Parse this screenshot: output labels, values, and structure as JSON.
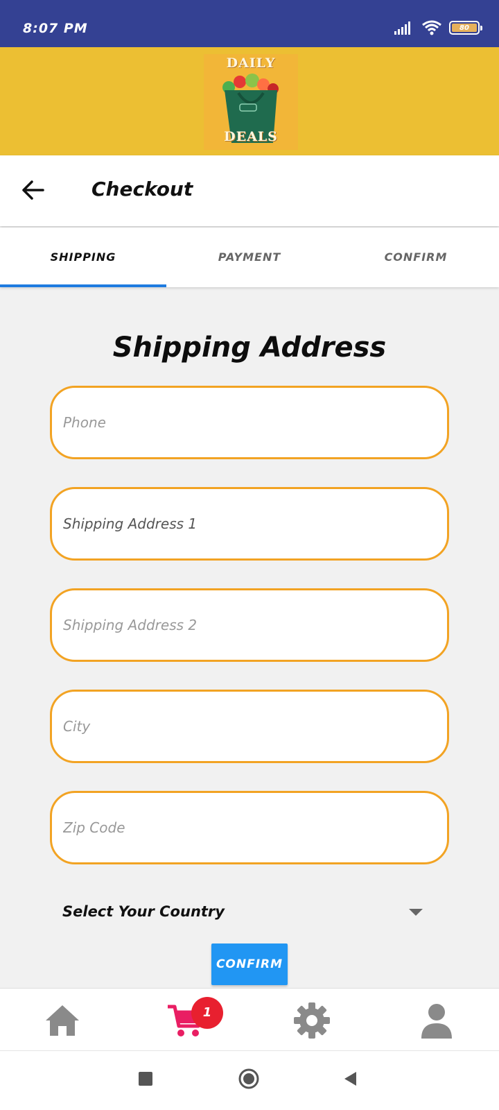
{
  "status_bar": {
    "time": "8:07 PM",
    "battery_level": "80"
  },
  "brand": {
    "logo_top": "DAILY",
    "logo_bottom": "DEALS"
  },
  "app_bar": {
    "title": "Checkout"
  },
  "tabs": [
    {
      "label": "SHIPPING",
      "active": true
    },
    {
      "label": "PAYMENT",
      "active": false
    },
    {
      "label": "CONFIRM",
      "active": false
    }
  ],
  "form": {
    "title": "Shipping Address",
    "phone_placeholder": "Phone",
    "address1_placeholder": "Shipping Address 1",
    "address2_placeholder": "Shipping Address 2",
    "city_placeholder": "City",
    "zip_placeholder": "Zip Code",
    "country_label": "Select Your Country",
    "confirm_label": "CONFIRM"
  },
  "bottom_nav": {
    "cart_count": "1"
  },
  "colors": {
    "status_bar": "#344193",
    "banner": "#ecbf33",
    "field_border": "#f2a323",
    "tab_indicator": "#1e7be0",
    "confirm_button": "#2196f3",
    "cart_icon": "#e91e63",
    "badge": "#e8202f"
  }
}
